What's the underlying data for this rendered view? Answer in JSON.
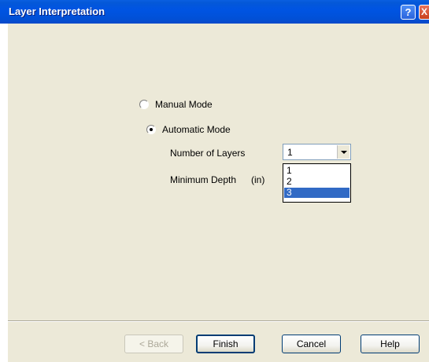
{
  "window": {
    "title": "Layer Interpretation",
    "help_button": "?",
    "close_button": "X"
  },
  "mode": {
    "manual_label": "Manual Mode",
    "automatic_label": "Automatic Mode",
    "selected": "automatic"
  },
  "layers": {
    "label": "Number of Layers",
    "value": "1",
    "options": [
      "1",
      "2",
      "3"
    ],
    "highlighted_option": "3"
  },
  "min_depth": {
    "label": "Minimum Depth",
    "unit": "(in)"
  },
  "buttons": {
    "back": "< Back",
    "finish": "Finish",
    "cancel": "Cancel",
    "help": "Help"
  },
  "colors": {
    "titlebar": "#0054e3",
    "dialog_bg": "#ece9d8",
    "selection": "#316ac5"
  }
}
